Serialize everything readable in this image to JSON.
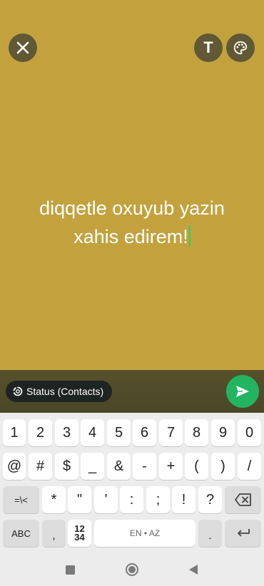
{
  "status_text": {
    "line1": "diqqetle oxuyub yazin",
    "line2": "xahis edirem!"
  },
  "toolbar": {
    "close_icon": "close-icon",
    "text_button_label": "T",
    "palette_icon": "palette-icon"
  },
  "bottom_bar": {
    "audience_label": "Status (Contacts)",
    "send_icon": "send-icon"
  },
  "keyboard": {
    "row1": [
      "1",
      "2",
      "3",
      "4",
      "5",
      "6",
      "7",
      "8",
      "9",
      "0"
    ],
    "row2": [
      "@",
      "#",
      "$",
      "_",
      "&",
      "-",
      "+",
      "(",
      ")",
      "/"
    ],
    "row3_mod": "=\\<",
    "row3": [
      "*",
      "\"",
      "'",
      ":",
      ";",
      "!",
      "?"
    ],
    "row4_abc": "ABC",
    "row4_comma": ",",
    "row4_numpad_top": "12",
    "row4_numpad_bottom": "34",
    "row4_space": "EN • AZ",
    "row4_period": "."
  },
  "colors": {
    "background": "#c3a23e",
    "send": "#23b462",
    "caret": "#25d366"
  }
}
